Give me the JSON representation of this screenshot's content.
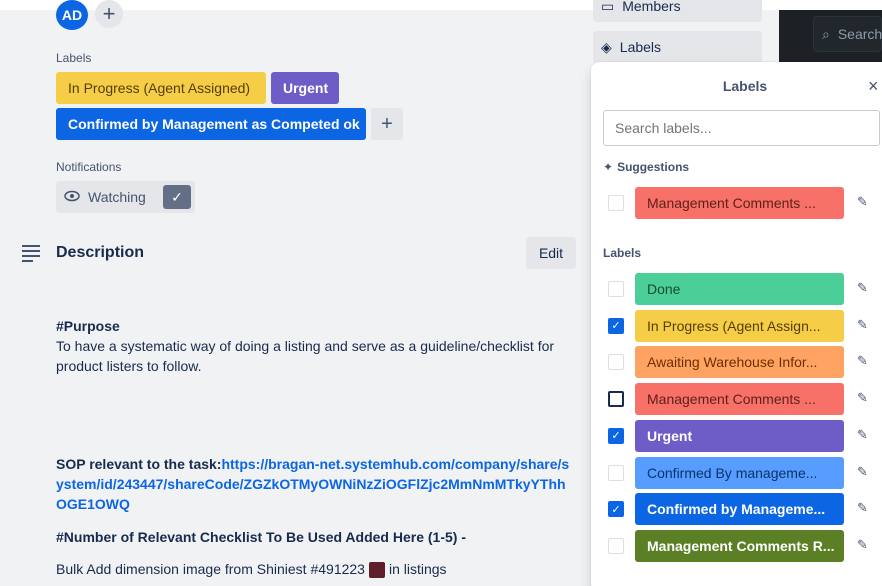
{
  "header": {
    "search_placeholder": "Search"
  },
  "members": {
    "avatar_initials": "AD",
    "add_symbol": "+"
  },
  "labels_section": {
    "title": "Labels",
    "chips": [
      {
        "text": "In Progress (Agent Assigned)",
        "color": "#f5cd47"
      },
      {
        "text": "Urgent",
        "color": "#6e5dc6"
      },
      {
        "text": "Confirmed by Management as Competed ok",
        "color": "#0c66e4"
      }
    ],
    "add_symbol": "+"
  },
  "notifications": {
    "title": "Notifications",
    "watch_label": "Watching",
    "check": "✓"
  },
  "description": {
    "title": "Description",
    "edit_label": "Edit",
    "purpose_heading": "#Purpose",
    "purpose_text": "To have a systematic way of doing a listing and serve as a guideline/checklist for product listers to follow.",
    "sop_label": "SOP relevant to the task:",
    "sop_link": "https://bragan-net.systemhub.com/company/share/system/id/243447/shareCode/ZGZkOTMyOWNiNzZiOGFlZjc2MmNmMTkyYThhOGE1OWQ",
    "checklist_heading": "#Number of Relevant Checklist To Be Used Added Here (1-5) -",
    "bulk_text_before": "Bulk Add dimension image from Shiniest #491223",
    "bulk_text_after": "in listings"
  },
  "sidebar": {
    "members_label": "Members",
    "labels_label": "Labels"
  },
  "labels_popover": {
    "title": "Labels",
    "close_icon": "×",
    "search_placeholder": "Search labels...",
    "suggestions_title": "Suggestions",
    "suggestions": [
      {
        "text": "Management Comments ...",
        "color": "#f87168",
        "text_color": "#5d1f1a",
        "checked": false
      }
    ],
    "labels_title": "Labels",
    "labels": [
      {
        "text": "Done",
        "color": "#4bce97",
        "text_color": "#164b35",
        "checked": false
      },
      {
        "text": "In Progress (Agent Assign...",
        "color": "#f5cd47",
        "text_color": "#533f04",
        "checked": true
      },
      {
        "text": "Awaiting Warehouse Infor...",
        "color": "#fea362",
        "text_color": "#702e00",
        "checked": false
      },
      {
        "text": "Management Comments ...",
        "color": "#f87168",
        "text_color": "#5d1f1a",
        "checked": false,
        "outlined": true
      },
      {
        "text": "Urgent",
        "color": "#6e5dc6",
        "text_color": "#ffffff",
        "checked": true
      },
      {
        "text": "Confirmed By manageme...",
        "color": "#579dff",
        "text_color": "#09326c",
        "checked": false
      },
      {
        "text": "Confirmed by Manageme...",
        "color": "#0c66e4",
        "text_color": "#ffffff",
        "checked": true
      },
      {
        "text": "Management Comments R...",
        "color": "#5b7f24",
        "text_color": "#ffffff",
        "checked": false
      }
    ]
  }
}
